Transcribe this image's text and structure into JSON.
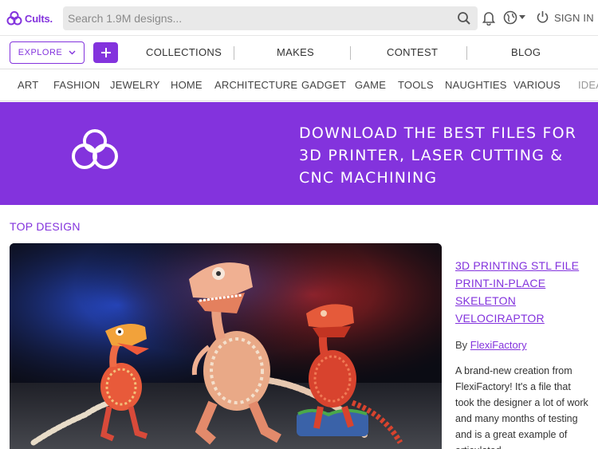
{
  "header": {
    "logo_text": "Cults.",
    "search_placeholder": "Search 1.9M designs...",
    "signin_label": "SIGN IN"
  },
  "nav": {
    "explore_label": "EXPLORE",
    "links": [
      "COLLECTIONS",
      "MAKES",
      "CONTEST",
      "BLOG"
    ]
  },
  "categories": [
    "ART",
    "FASHION",
    "JEWELRY",
    "HOME",
    "ARCHITECTURE",
    "GADGET",
    "GAME",
    "TOOLS",
    "NAUGHTIES",
    "VARIOUS",
    "IDEAS"
  ],
  "banner": {
    "text": "DOWNLOAD THE BEST FILES FOR 3D PRINTER, LASER CUTTING & CNC MACHINING"
  },
  "top_design": {
    "section_title": "TOP DESIGN",
    "title": "3D PRINTING STL FILE PRINT-IN-PLACE SKELETON VELOCIRAPTOR",
    "by_label": "By",
    "author": "FlexiFactory",
    "description": "A brand-new creation from FlexiFactory! It's a file that took the designer a lot of work and many months of testing and is a great example of articulated"
  },
  "colors": {
    "accent": "#8333dd"
  }
}
